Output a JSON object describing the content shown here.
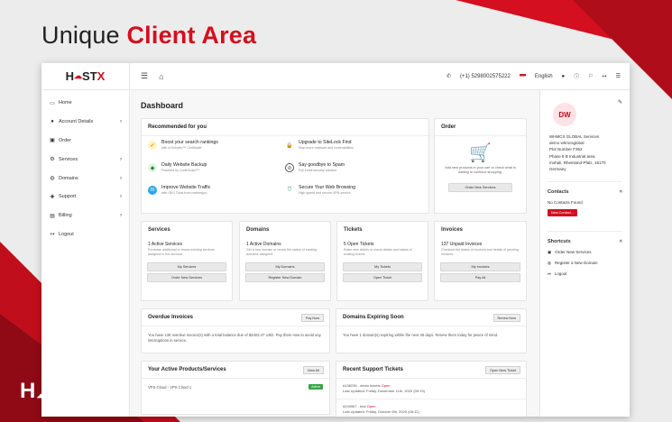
{
  "headline": {
    "word1": "Unique",
    "word2": "Client Area"
  },
  "brand": {
    "logo_pre": "H",
    "logo_mid": "ST",
    "logo_x": "X",
    "accent": "#d40f1f"
  },
  "topbar": {
    "phone": "(+1) 5298002575222",
    "language": "English",
    "icons": [
      "menu-icon",
      "home-icon",
      "user-icon",
      "cart-icon",
      "logout-icon"
    ]
  },
  "sidebar": {
    "items": [
      {
        "label": "Home",
        "icon": "monitor-icon",
        "chev": ""
      },
      {
        "label": "Account Details",
        "icon": "user-icon",
        "chev": "›"
      },
      {
        "label": "Order",
        "icon": "cart-icon",
        "chev": ""
      },
      {
        "label": "Services",
        "icon": "gear-icon",
        "chev": "›"
      },
      {
        "label": "Domains",
        "icon": "globe-icon",
        "chev": "›"
      },
      {
        "label": "Support",
        "icon": "support-icon",
        "chev": "›"
      },
      {
        "label": "Billing",
        "icon": "billing-icon",
        "chev": "›"
      },
      {
        "label": "Logout",
        "icon": "logout-icon",
        "chev": ""
      }
    ]
  },
  "dashboard": {
    "title": "Dashboard",
    "recommended": {
      "title": "Recommended for you",
      "items": [
        {
          "title": "Boost your search rankings",
          "sub": "with a NoIndex™ Certificate"
        },
        {
          "title": "Upgrade to SiteLock Find",
          "sub": "Stop more malware and vulnerabilities"
        },
        {
          "title": "Daily Website Backup",
          "sub": "Powered by CodeGuard™"
        },
        {
          "title": "Say goodbye to Spam",
          "sub": "Full email security solution"
        },
        {
          "title": "Improve Website Traffic",
          "sub": "with SEO Tools from marketgoo"
        },
        {
          "title": "Secure Your Web Browsing",
          "sub": "High speed and secure VPN service"
        }
      ]
    },
    "order": {
      "title": "Order",
      "text": "Add new products in your cart or check what is waiting to continue shopping.",
      "button": "Order New Services"
    },
    "services": {
      "title": "Services",
      "value": "1 Active Services",
      "desc": "Purchase additional or renew existing services assigned to the account.",
      "btn1": "My Services",
      "btn2": "Order New Services"
    },
    "domains": {
      "title": "Domains",
      "value": "1 Active Domains",
      "desc": "Get a new domain or renew the status of existing domains assigned.",
      "btn1": "My Domains",
      "btn2": "Register New Domain"
    },
    "tickets": {
      "title": "Tickets",
      "value": "5 Open Tickets",
      "desc": "Raise new tickets or check details and status of existing tickets.",
      "btn1": "My Tickets",
      "btn2": "Open Ticket"
    },
    "invoices": {
      "title": "Invoices",
      "value": "137 Unpaid Invoices",
      "desc": "Checkout the status of invoices and details of pending invoices.",
      "btn1": "My Invoices",
      "btn2": "Pay All"
    },
    "overdue": {
      "title": "Overdue Invoices",
      "button": "Pay Now",
      "text": "You have 138 overdue invoice(s) with a total balance due of $3403.47 USD. Pay them now to avoid any interruptions in service."
    },
    "expiring": {
      "title": "Domains Expiring Soon",
      "button": "Renew Now",
      "text": "You have 1 domain(s) expiring within the next 45 days. Renew them today for peace of mind."
    },
    "products": {
      "title": "Your Active Products/Services",
      "button": "View All",
      "item": "VPS Cloud - VPS Cloud 1",
      "status": "Active"
    },
    "support": {
      "title": "Recent Support Tickets",
      "button": "Open New Ticket",
      "t1": "#138236 - demo tickets",
      "t1_status": "Open",
      "t1_date": "Last Updated: Friday, December 11th, 2020 (05:19)",
      "t2": "#243967 - test",
      "t2_status": "Open",
      "t2_date": "Last Updated: Friday, October 9th, 2020 (08:12)"
    }
  },
  "profile": {
    "initials": "DW",
    "lines": [
      "WHMCS GLOBAL Services",
      "demo whmcsglobal",
      "Plot Number F352",
      "Phase 8 B Industrial area",
      "mohali, Rheinland-Pfalz, 15170",
      "Germany"
    ],
    "contacts_title": "Contacts",
    "contacts_text": "No Contacts Found",
    "new_contact": "New Contact...",
    "shortcuts_title": "Shortcuts",
    "shortcuts": [
      "Order New Services",
      "Register a New Domain",
      "Logout"
    ]
  }
}
